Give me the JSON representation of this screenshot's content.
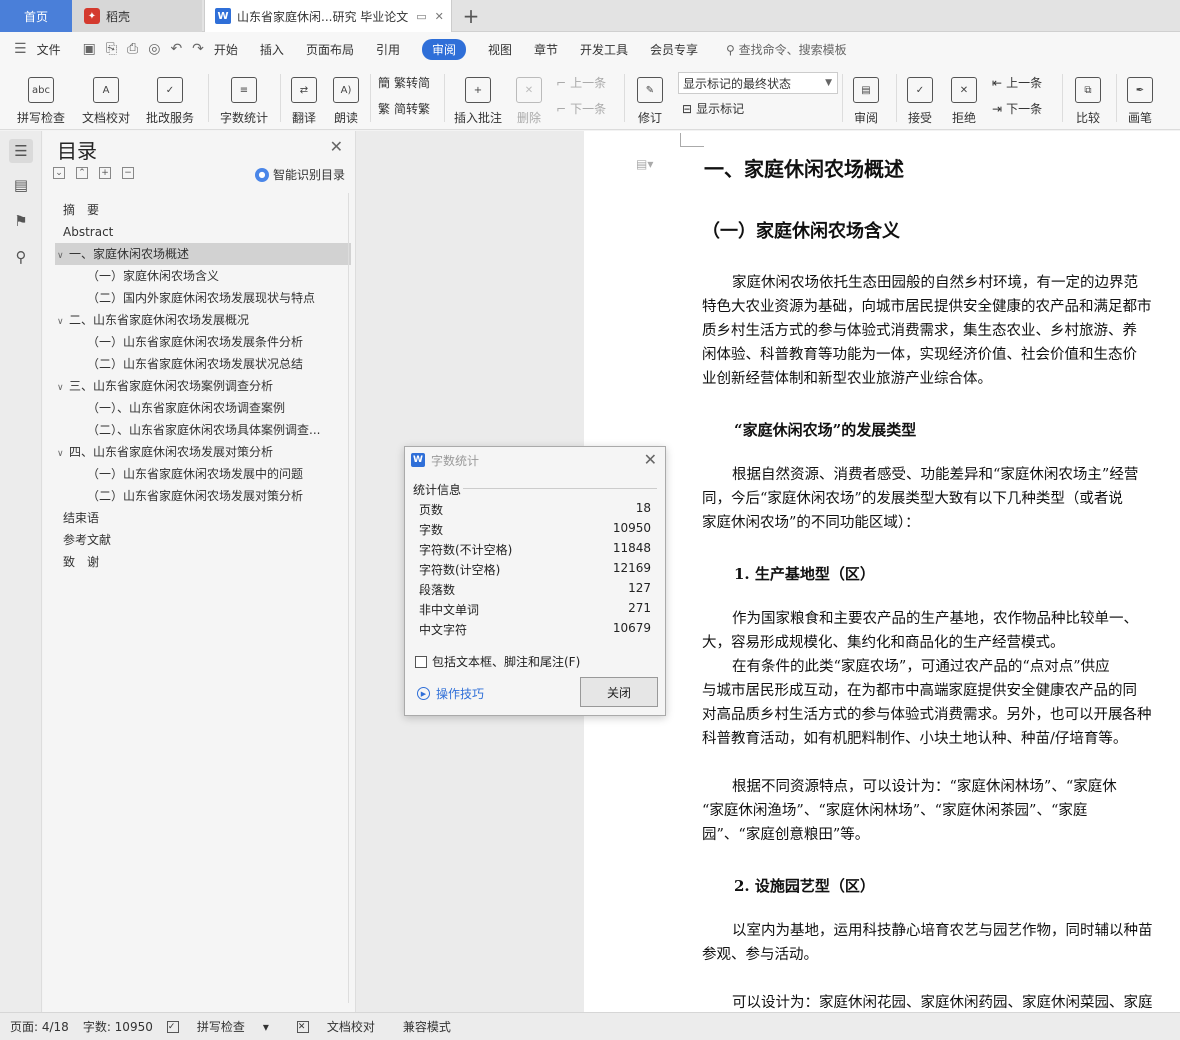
{
  "tabs": {
    "home": "首页",
    "wps": "稻壳",
    "doc": "山东省家庭休闲...研究 毕业论文",
    "add": "+"
  },
  "menu": {
    "file": "文件",
    "items": [
      "开始",
      "插入",
      "页面布局",
      "引用",
      "审阅",
      "视图",
      "章节",
      "开发工具",
      "会员专享"
    ],
    "search": "查找命令、搜索模板"
  },
  "ribbon": {
    "spell_check": "拼写检查",
    "doc_proof": "文档校对",
    "batch_service": "批改服务",
    "word_count": "字数统计",
    "translate": "翻译",
    "read_aloud": "朗读",
    "trad_to_simp": "繁转简",
    "simp_to_trad": "简转繁",
    "insert_comment": "插入批注",
    "delete": "删除",
    "prev": "上一条",
    "next": "下一条",
    "track": "修订",
    "show_markup_select": "显示标记的最终状态",
    "show_markup": "显示标记",
    "review": "审阅",
    "accept": "接受",
    "reject": "拒绝",
    "prev2": "上一条",
    "next2": "下一条",
    "compare": "比较",
    "pen": "画笔"
  },
  "toc": {
    "title": "目录",
    "smart": "智能识别目录",
    "items": [
      {
        "text": "摘　要",
        "level": 0
      },
      {
        "text": "Abstract",
        "level": 0
      },
      {
        "text": "一、家庭休闲农场概述",
        "level": 0
      },
      {
        "text": "（一）家庭休闲农场含义",
        "level": 1
      },
      {
        "text": "（二）国内外家庭休闲农场发展现状与特点",
        "level": 1
      },
      {
        "text": "二、山东省家庭休闲农场发展概况",
        "level": 0
      },
      {
        "text": "（一）山东省家庭休闲农场发展条件分析",
        "level": 1
      },
      {
        "text": "（二）山东省家庭休闲农场发展状况总结",
        "level": 1
      },
      {
        "text": "三、山东省家庭休闲农场案例调查分析",
        "level": 0
      },
      {
        "text": "（一）、山东省家庭休闲农场调查案例",
        "level": 1
      },
      {
        "text": "（二）、山东省家庭休闲农场具体案例调查...",
        "level": 1
      },
      {
        "text": "四、山东省家庭休闲农场发展对策分析",
        "level": 0
      },
      {
        "text": "（一）山东省家庭休闲农场发展中的问题",
        "level": 1
      },
      {
        "text": "（二）山东省家庭休闲农场发展对策分析",
        "level": 1
      },
      {
        "text": "结束语",
        "level": 0
      },
      {
        "text": "参考文献",
        "level": 0
      },
      {
        "text": "致　谢",
        "level": 0
      }
    ]
  },
  "doc": {
    "h1": "一、家庭休闲农场概述",
    "h2": "（一）家庭休闲农场含义",
    "p1": [
      "家庭休闲农场依托生态田园般的自然乡村环境，有一定的边界范",
      "特色大农业资源为基础，向城市居民提供安全健康的农产品和满足都市",
      "质乡村生活方式的参与体验式消费需求，集生态农业、乡村旅游、养",
      "闲体验、科普教育等功能为一体，实现经济价值、社会价值和生态价",
      "业创新经营体制和新型农业旅游产业综合体。"
    ],
    "h3a": "“家庭休闲农场”的发展类型",
    "p2": [
      "根据自然资源、消费者感受、功能差异和“家庭休闲农场主”经营",
      "同，今后“家庭休闲农场”的发展类型大致有以下几种类型（或者说",
      "家庭休闲农场”的不同功能区域）："
    ],
    "h3b": "1. 生产基地型（区）",
    "p3": [
      "作为国家粮食和主要农产品的生产基地，农作物品种比较单一、",
      "大，容易形成规模化、集约化和商品化的生产经营模式。",
      "在有条件的此类“家庭农场”，可通过农产品的“点对点”供应",
      "与城市居民形成互动，在为都市中高端家庭提供安全健康农产品的同",
      "对高品质乡村生活方式的参与体验式消费需求。另外，也可以开展各种",
      "科普教育活动，如有机肥料制作、小块土地认种、种苗/仔培育等。"
    ],
    "p4": [
      "根据不同资源特点，可以设计为：“家庭休闲林场”、“家庭休",
      "“家庭休闲渔场”、“家庭休闲林场”、“家庭休闲茶园”、“家庭",
      "园”、“家庭创意粮田”等。"
    ],
    "h3c": "2. 设施园艺型（区）",
    "p5": [
      "以室内为基地，运用科技静心培育农艺与园艺作物，同时辅以种苗",
      "参观、参与活动。"
    ],
    "p6": [
      "可以设计为：家庭休闲花园、家庭休闲药园、家庭休闲菜园、家庭"
    ]
  },
  "dialog": {
    "title": "字数统计",
    "section": "统计信息",
    "rows": [
      {
        "label": "页数",
        "value": "18"
      },
      {
        "label": "字数",
        "value": "10950"
      },
      {
        "label": "字符数(不计空格)",
        "value": "11848"
      },
      {
        "label": "字符数(计空格)",
        "value": "12169"
      },
      {
        "label": "段落数",
        "value": "127"
      },
      {
        "label": "非中文单词",
        "value": "271"
      },
      {
        "label": "中文字符",
        "value": "10679"
      }
    ],
    "checkbox": "包括文本框、脚注和尾注(F)",
    "tip": "操作技巧",
    "close": "关闭"
  },
  "status": {
    "page": "页面: 4/18",
    "words": "字数: 10950",
    "spell": "拼写检查",
    "proof": "文档校对",
    "compat": "兼容模式"
  }
}
